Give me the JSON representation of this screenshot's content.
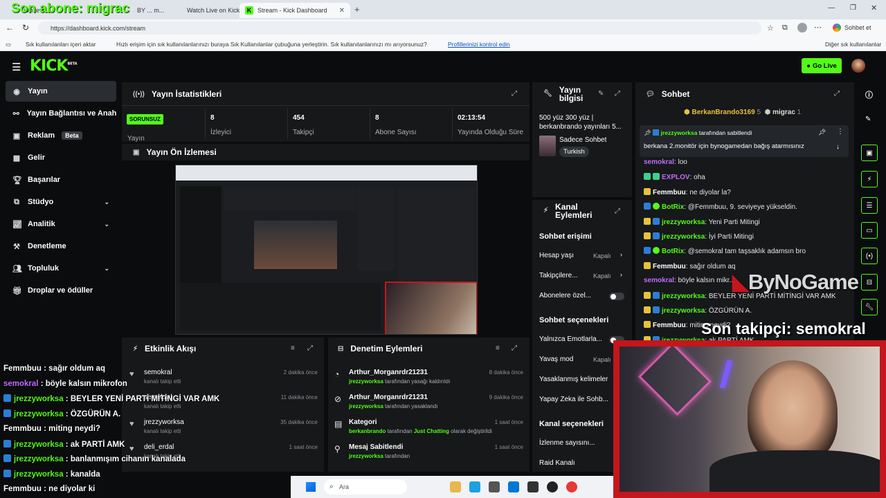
{
  "browser": {
    "tabs": [
      {
        "label": "Whiteve...",
        "active": false
      },
      {
        "label": "BY ... m...",
        "active": false
      },
      {
        "label": "Watch Live on Kick",
        "active": false
      },
      {
        "label": "Stream - Kick Dashboard",
        "active": true
      }
    ],
    "url": "https://dashboard.kick.com/stream",
    "profile_label": "Sohbet et",
    "favbar": {
      "import": "Sık kullanılanları içeri aktar",
      "message": "Hızlı erişim için sık kullanılanlarınızı buraya Sık Kullanılanlar çubuğuna yerleştirin. Sık kullanılanlarınızı mı arıyorsunuz?",
      "link": "Profillerinizi kontrol edin",
      "other": "Diğer sık kullanılanlar"
    }
  },
  "overlay": {
    "top_text": "Son abone: migrac",
    "follower_text": "Son takipçi: semokral",
    "brand": "ByNoGame",
    "chat": [
      {
        "user": "Femmbuu",
        "text": " : sağır oldum aq",
        "color": "#ffffff",
        "badge": false
      },
      {
        "user": "semokral",
        "text": " : böyle kalsın mikrofon",
        "color": "#c06cff",
        "badge": false
      },
      {
        "user": "jrezzyworksa",
        "text": " : BEYLER YENİ PARTİ MİTİNGİ VAR AMK",
        "color": "#53fc18",
        "badge": true
      },
      {
        "user": "jrezzyworksa",
        "text": " : ÖZGÜRÜN A.",
        "color": "#53fc18",
        "badge": true
      },
      {
        "user": "Femmbuu",
        "text": " : miting neydi?",
        "color": "#ffffff",
        "badge": false
      },
      {
        "user": "jrezzyworksa",
        "text": " : ak PARTİ AMK",
        "color": "#53fc18",
        "badge": true
      },
      {
        "user": "jrezzyworksa",
        "text": " : banlanmışım cihanın kanalada",
        "color": "#53fc18",
        "badge": true
      },
      {
        "user": "jrezzyworksa",
        "text": " : kanalda",
        "color": "#53fc18",
        "badge": true
      },
      {
        "user": "Femmbuu",
        "text": " : ne diyolar ki",
        "color": "#ffffff",
        "badge": false
      }
    ]
  },
  "app": {
    "logo": "KICK",
    "logo_sup": "BETA",
    "go_live": "Go Live",
    "sidebar": [
      {
        "label": "Yayın",
        "icon": "broadcast-icon",
        "glyph": "◉",
        "active": true,
        "chevron": false,
        "badge": ""
      },
      {
        "label": "Yayın Bağlantısı ve Anahtarı",
        "icon": "link-icon",
        "glyph": "⚯",
        "active": false,
        "chevron": false,
        "badge": ""
      },
      {
        "label": "Reklam",
        "icon": "ad-icon",
        "glyph": "▣",
        "active": false,
        "chevron": false,
        "badge": "Beta"
      },
      {
        "label": "Gelir",
        "icon": "revenue-icon",
        "glyph": "▦",
        "active": false,
        "chevron": false,
        "badge": ""
      },
      {
        "label": "Başarılar",
        "icon": "trophy-icon",
        "glyph": "🏆︎",
        "active": false,
        "chevron": false,
        "badge": ""
      },
      {
        "label": "Stüdyo",
        "icon": "studio-icon",
        "glyph": "⧉",
        "active": false,
        "chevron": true,
        "badge": ""
      },
      {
        "label": "Analitik",
        "icon": "analytics-icon",
        "glyph": "📈︎",
        "active": false,
        "chevron": true,
        "badge": ""
      },
      {
        "label": "Denetleme",
        "icon": "hammer-icon",
        "glyph": "⚒",
        "active": false,
        "chevron": false,
        "badge": ""
      },
      {
        "label": "Topluluk",
        "icon": "community-icon",
        "glyph": "👥︎",
        "active": false,
        "chevron": true,
        "badge": ""
      },
      {
        "label": "Droplar ve ödüller",
        "icon": "gift-icon",
        "glyph": "🎁︎",
        "active": false,
        "chevron": false,
        "badge": ""
      }
    ],
    "stats": {
      "title": "Yayın İstatistikleri",
      "status_badge": "SORUNSUZ",
      "status_label": "Yayın",
      "items": [
        {
          "value": "8",
          "label": "İzleyici"
        },
        {
          "value": "454",
          "label": "Takipçi"
        },
        {
          "value": "8",
          "label": "Abone Sayısı"
        },
        {
          "value": "02:13:54",
          "label": "Yayında Olduğu Süre"
        }
      ]
    },
    "preview": {
      "title": "Yayın Ön İzlemesi"
    },
    "stream_info": {
      "title": "Yayın bilgisi",
      "stream_title": "500 yüz 300 yüz | berkanbrando yayınları 5...",
      "category": "Sadece Sohbet",
      "language": "Turkish"
    },
    "channel_actions": {
      "title": "Kanal Eylemleri",
      "section1": "Sohbet erişimi",
      "age_label": "Hesap yaşı",
      "age_value": "Kapalı",
      "followers_label": "Takipçilere...",
      "followers_value": "Kapalı",
      "subs_label": "Abonelere özel...",
      "section2": "Sohbet seçenekleri",
      "emotes_label": "Yalnızca Emotlarla...",
      "slow_label": "Yavaş mod",
      "slow_value": "Kapalı",
      "banned_words": "Yasaklanmış kelimeler",
      "ai_label": "Yapay Zeka ile Sohb...",
      "section3": "Kanal seçenekleri",
      "viewcount_label": "İzlenme sayısını...",
      "raid_label": "Raid Kanalı"
    },
    "activity": {
      "title": "Etkinlik Akışı",
      "items": [
        {
          "user": "semokral",
          "desc": "kanalı takip etti",
          "time": "2 dakika önce"
        },
        {
          "user": "semokral",
          "desc": "kanalı takip etti",
          "time": "11 dakika önce"
        },
        {
          "user": "jrezzyworksa",
          "desc": "kanalı takip etti",
          "time": "35 dakika önce"
        },
        {
          "user": "deli_erdal",
          "desc": "kanalı takip etti",
          "time": "1 saat önce"
        }
      ]
    },
    "moderation": {
      "title": "Denetim Eylemleri",
      "items": [
        {
          "title": "Arthur_Morganrdr21231",
          "line_user": "jrezzyworksa",
          "line_text": " tarafından yasağı kaldırıldı",
          "extra": "",
          "extra2": "",
          "time": "8 dakika önce",
          "icon": "unban-icon",
          "glyph": "◔"
        },
        {
          "title": "Arthur_Morganrdr21231",
          "line_user": "jrezzyworksa",
          "line_text": " tarafından yasaklandı",
          "extra": "",
          "extra2": "",
          "time": "9 dakika önce",
          "icon": "ban-icon",
          "glyph": "⊘"
        },
        {
          "title": "Kategori",
          "line_user": "berkanbrando",
          "line_text": " tarafından ",
          "extra": "Just Chatting",
          "extra2": " olarak değiştirildi",
          "time": "1 saat önce",
          "icon": "category-icon",
          "glyph": "▤"
        },
        {
          "title": "Mesaj Sabitlendi",
          "line_user": "jrezzyworksa",
          "line_text": " tarafından",
          "extra": "",
          "extra2": "",
          "time": "1 saat önce",
          "icon": "pin-icon",
          "glyph": "⚲"
        }
      ]
    },
    "chat": {
      "title": "Sohbet",
      "top_users": [
        {
          "name": "BerkanBrando3169",
          "count": "5"
        },
        {
          "name": "migrac",
          "count": "1"
        }
      ],
      "pinned_by_user": "jrezzyworksa",
      "pinned_by_text": " tarafından sabitlendi",
      "pinned_text": "berkana 2.monitör için bynogamedan bağış atarmısınız",
      "messages": [
        {
          "user": "semokral",
          "text": ": loo",
          "color": "#c06cff",
          "badges": []
        },
        {
          "user": "EXPLOV",
          "text": ": oha",
          "color": "#c06cff",
          "badges": [
            "b-v",
            "b-v"
          ]
        },
        {
          "user": "Femmbuu",
          "text": ": ne diyolar la?",
          "color": "#ffffff",
          "badges": [
            "b-m"
          ]
        },
        {
          "user": "BotRix",
          "text": ": @Femmbuu, 9. seviyeye yükseldin.",
          "color": "#53fc18",
          "badges": [
            "b-sub",
            "b-ver"
          ]
        },
        {
          "user": "jrezzyworksa",
          "text": ": Yeni Parti Mitingi",
          "color": "#53fc18",
          "badges": [
            "b-m",
            "b-sub"
          ]
        },
        {
          "user": "jrezzyworksa",
          "text": ": İyi Parti Mitingi",
          "color": "#53fc18",
          "badges": [
            "b-m",
            "b-sub"
          ]
        },
        {
          "user": "BotRix",
          "text": ": @semokral tam taşsaklık adamsın bro",
          "color": "#53fc18",
          "badges": [
            "b-sub",
            "b-ver"
          ]
        },
        {
          "user": "Femmbuu",
          "text": ": sağır oldum aq",
          "color": "#ffffff",
          "badges": [
            "b-m"
          ]
        },
        {
          "user": "semokral",
          "text": ": böyle kalsın mikr...",
          "color": "#c06cff",
          "badges": []
        },
        {
          "user": "jrezzyworksa",
          "text": ": BEYLER YENİ PARTİ MİTİNGİ VAR AMK",
          "color": "#53fc18",
          "badges": [
            "b-m",
            "b-sub"
          ]
        },
        {
          "user": "jrezzyworksa",
          "text": ": ÖZGÜRÜN A.",
          "color": "#53fc18",
          "badges": [
            "b-m",
            "b-sub"
          ]
        },
        {
          "user": "Femmbuu",
          "text": ": miting neydi?",
          "color": "#ffffff",
          "badges": [
            "b-m"
          ]
        },
        {
          "user": "jrezzyworksa",
          "text": ": ak PARTİ AMK",
          "color": "#53fc18",
          "badges": [
            "b-m",
            "b-sub"
          ]
        }
      ]
    }
  },
  "taskbar": {
    "search_placeholder": "Ara"
  },
  "colors": {
    "accent": "#53fc18",
    "panel": "#16181a",
    "background": "#0b0c0d"
  }
}
